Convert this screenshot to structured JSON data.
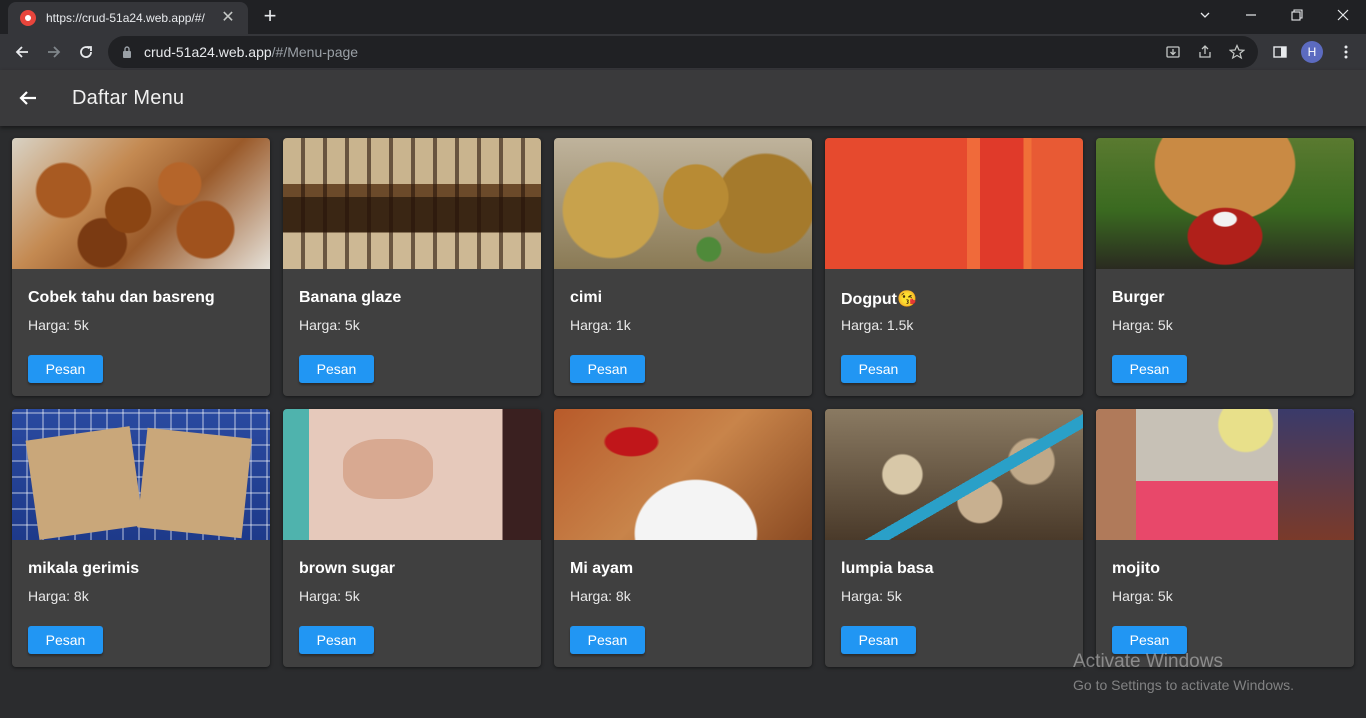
{
  "browser": {
    "tab_title": "https://crud-51a24.web.app/#/",
    "url_host": "crud-51a24.web.app",
    "url_path": "/#/Menu-page",
    "profile_initial": "H"
  },
  "app": {
    "title": "Daftar Menu"
  },
  "menu": [
    {
      "name": "Cobek tahu dan basreng",
      "price": "Harga: 5k",
      "button": "Pesan"
    },
    {
      "name": "Banana glaze",
      "price": "Harga: 5k",
      "button": "Pesan"
    },
    {
      "name": "cimi",
      "price": "Harga: 1k",
      "button": "Pesan"
    },
    {
      "name": "Dogput😘",
      "price": "Harga: 1.5k",
      "button": "Pesan"
    },
    {
      "name": "Burger",
      "price": "Harga: 5k",
      "button": "Pesan"
    },
    {
      "name": "mikala gerimis",
      "price": "Harga: 8k",
      "button": "Pesan"
    },
    {
      "name": "brown sugar",
      "price": "Harga: 5k",
      "button": "Pesan"
    },
    {
      "name": "Mi ayam",
      "price": "Harga: 8k",
      "button": "Pesan"
    },
    {
      "name": "lumpia basa",
      "price": "Harga: 5k",
      "button": "Pesan"
    },
    {
      "name": "mojito",
      "price": "Harga: 5k",
      "button": "Pesan"
    }
  ],
  "watermark": {
    "title": "Activate Windows",
    "subtitle": "Go to Settings to activate Windows."
  },
  "colors": {
    "accent": "#2196f3",
    "background": "#2b2c2e",
    "card": "#404040"
  }
}
